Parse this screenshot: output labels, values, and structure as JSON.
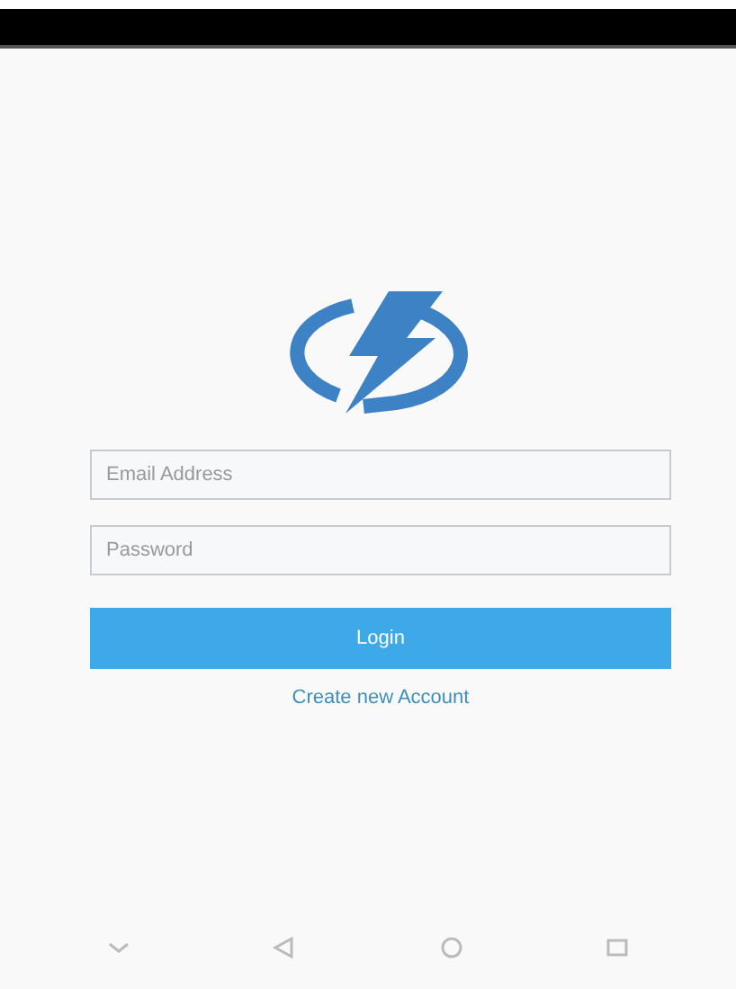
{
  "login_form": {
    "email_field": {
      "placeholder": "Email Address"
    },
    "password_field": {
      "placeholder": "Password"
    },
    "login_button": "Login",
    "create_account_link": "Create new Account"
  }
}
